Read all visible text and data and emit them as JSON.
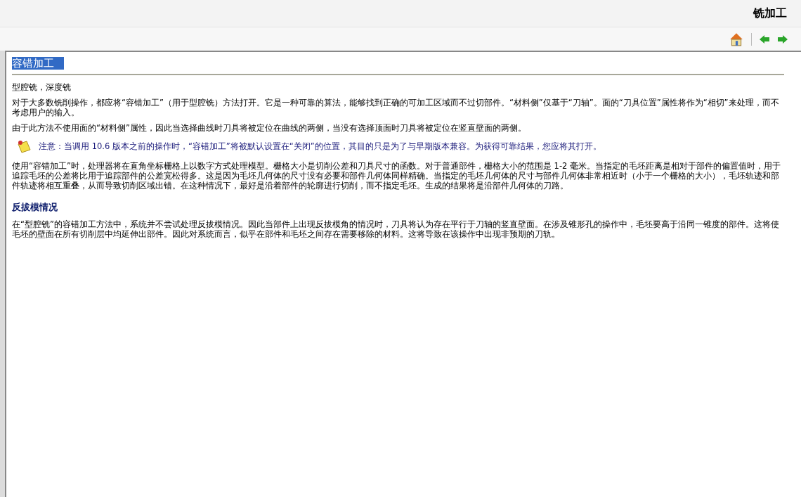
{
  "window": {
    "title": "铣加工"
  },
  "article": {
    "title": "容错加工",
    "blocks": [
      {
        "kind": "paragraph",
        "text": "型腔铣，深度铣"
      },
      {
        "kind": "paragraph",
        "text": "对于大多数铣削操作，都应将“容错加工”（用于型腔铣）方法打开。它是一种可靠的算法，能够找到正确的可加工区域而不过切部件。“材料侧”仅基于“刀轴”。面的“刀具位置”属性将作为“相切”来处理，而不考虑用户的输入。"
      },
      {
        "kind": "paragraph",
        "text": "由于此方法不使用面的“材料侧”属性，因此当选择曲线时刀具将被定位在曲线的两侧，当没有选择顶面时刀具将被定位在竖直壁面的两侧。"
      },
      {
        "kind": "note",
        "text": "注意：当调用 10.6 版本之前的操作时，“容错加工”将被默认设置在“关闭”的位置，其目的只是为了与早期版本兼容。为获得可靠结果，您应将其打开。"
      },
      {
        "kind": "paragraph",
        "text": "使用“容错加工”时，处理器将在直角坐标栅格上以数字方式处理模型。栅格大小是切削公差和刀具尺寸的函数。对于普通部件，栅格大小的范围是 1-2 毫米。当指定的毛坯距离是相对于部件的偏置值时，用于追踪毛坯的公差将比用于追踪部件的公差宽松得多。这是因为毛坯几何体的尺寸没有必要和部件几何体同样精确。当指定的毛坯几何体的尺寸与部件几何体非常相近时（小于一个栅格的大小），毛坯轨迹和部件轨迹将相互重叠，从而导致切削区域出错。在这种情况下，最好是沿着部件的轮廓进行切削，而不指定毛坯。生成的结果将是沿部件几何体的刀路。"
      },
      {
        "kind": "heading",
        "text": "反拔模情况"
      },
      {
        "kind": "paragraph",
        "text": "在“型腔铣”的容错加工方法中，系统并不尝试处理反拔模情况。因此当部件上出现反拔模角的情况时，刀具将认为存在平行于刀轴的竖直壁面。在涉及锥形孔的操作中，毛坯要高于沿同一锥度的部件。这将使毛坯的壁面在所有切削层中均延伸出部件。因此对系统而言，似乎在部件和毛坯之间存在需要移除的材料。这将导致在该操作中出现非预期的刀轨。"
      }
    ]
  }
}
